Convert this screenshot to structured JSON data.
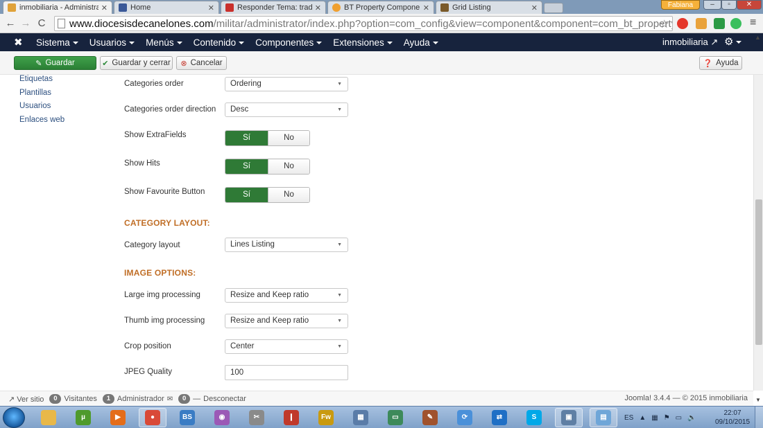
{
  "browser": {
    "tabs": [
      {
        "label": "inmobiliaria - Administrac",
        "color": "#e0a23a",
        "active": true
      },
      {
        "label": "Home",
        "color": "#3b5998",
        "active": false
      },
      {
        "label": "Responder Tema: traducci",
        "color": "#c9302c",
        "active": false
      },
      {
        "label": "BT Property Component -",
        "color": "#f0a030",
        "active": false
      },
      {
        "label": "Grid Listing",
        "color": "#7a5a2a",
        "active": false
      }
    ],
    "user_badge": "Fabiana",
    "url_host": "www.diocesisdecanelones.com",
    "url_path": "/militar/administrator/index.php?option=com_config&view=component&component=com_bt_property&path=&returr"
  },
  "adminbar": {
    "menu": [
      "Sistema",
      "Usuarios",
      "Menús",
      "Contenido",
      "Componentes",
      "Extensiones",
      "Ayuda"
    ],
    "site_name": "inmobiliaria"
  },
  "actions": {
    "save": "Guardar",
    "save_close": "Guardar y cerrar",
    "cancel": "Cancelar",
    "help": "Ayuda"
  },
  "sidebar": [
    "Etiquetas",
    "Plantillas",
    "Usuarios",
    "Enlaces web"
  ],
  "form": {
    "categories_order": {
      "label": "Categories order",
      "value": "Ordering"
    },
    "categories_order_direction": {
      "label": "Categories order direction",
      "value": "Desc"
    },
    "show_extrafields": {
      "label": "Show ExtraFields",
      "on": "Sí",
      "off": "No"
    },
    "show_hits": {
      "label": "Show Hits",
      "on": "Sí",
      "off": "No"
    },
    "show_favourite": {
      "label": "Show Favourite Button",
      "on": "Sí",
      "off": "No"
    },
    "section_category": "CATEGORY LAYOUT:",
    "category_layout": {
      "label": "Category layout",
      "value": "Lines Listing"
    },
    "section_image": "IMAGE OPTIONS:",
    "large_img": {
      "label": "Large img processing",
      "value": "Resize and Keep ratio"
    },
    "thumb_img": {
      "label": "Thumb img processing",
      "value": "Resize and Keep ratio"
    },
    "crop_position": {
      "label": "Crop position",
      "value": "Center"
    },
    "jpeg_quality": {
      "label": "JPEG Quality",
      "value": "100"
    }
  },
  "footer": {
    "view_site": "Ver sitio",
    "visitors_count": "0",
    "visitors": "Visitantes",
    "admins_count": "1",
    "admins": "Administrador",
    "messages_count": "0",
    "logout": "Desconectar",
    "version": "Joomla! 3.4.4 — © 2015 inmobiliaria"
  },
  "taskbar": {
    "lang": "ES",
    "time": "22:07",
    "date": "09/10/2015",
    "apps": [
      {
        "name": "explorer",
        "color": "#e8b84a",
        "text": ""
      },
      {
        "name": "utorrent",
        "color": "#4f9a2c",
        "text": "µ"
      },
      {
        "name": "media-player",
        "color": "#e46d1a",
        "text": "▶"
      },
      {
        "name": "chrome",
        "color": "#d94a38",
        "text": "●"
      },
      {
        "name": "bs-player",
        "color": "#3a7cc4",
        "text": "BS"
      },
      {
        "name": "picasa",
        "color": "#9b59b6",
        "text": "◉"
      },
      {
        "name": "tool",
        "color": "#8a8a8a",
        "text": "✂"
      },
      {
        "name": "lipstick",
        "color": "#c0392b",
        "text": "❙"
      },
      {
        "name": "fireworks",
        "color": "#c99a10",
        "text": "Fw"
      },
      {
        "name": "grid-app",
        "color": "#5a7ca8",
        "text": "▦"
      },
      {
        "name": "photo-viewer",
        "color": "#3d8a5a",
        "text": "▭"
      },
      {
        "name": "paint-tool",
        "color": "#a0522d",
        "text": "✎"
      },
      {
        "name": "sync-app",
        "color": "#4a90d9",
        "text": "⟳"
      },
      {
        "name": "teamviewer",
        "color": "#1f6fc5",
        "text": "⇄"
      },
      {
        "name": "skype",
        "color": "#00a8e8",
        "text": "S"
      },
      {
        "name": "remote-desktop",
        "color": "#5f7fa4",
        "text": "▣"
      },
      {
        "name": "notepad",
        "color": "#6fa6d8",
        "text": "▤"
      }
    ]
  }
}
